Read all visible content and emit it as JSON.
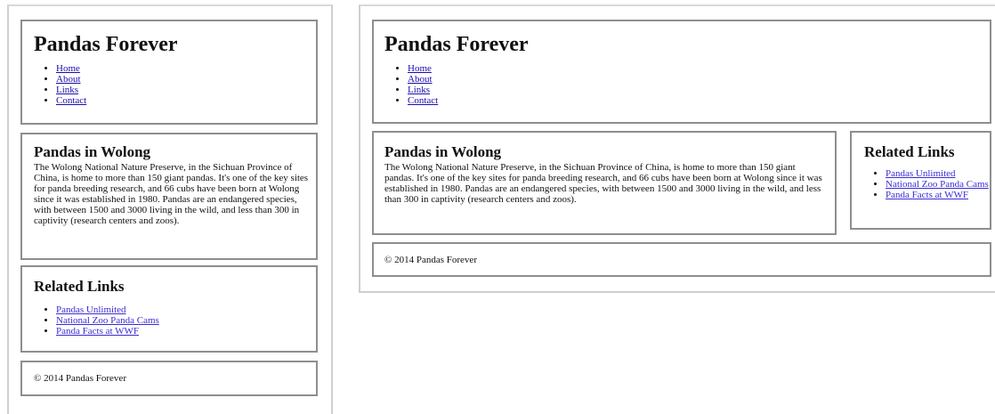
{
  "site_title": "Pandas Forever",
  "nav": [
    "Home",
    "About",
    "Links",
    "Contact"
  ],
  "article": {
    "heading": "Pandas in Wolong",
    "text": "The Wolong National Nature Preserve, in the Sichuan Province of China, is home to more than 150 giant pandas. It's one of the key sites for panda breeding research, and 66 cubs have been born at Wolong since it was established in 1980. Pandas are an endangered species, with between 1500 and 3000 living in the wild, and less than 300 in captivity (research centers and zoos)."
  },
  "related": {
    "heading": "Related Links",
    "links": [
      "Pandas Unlimited",
      "National Zoo Panda Cams",
      "Panda Facts at WWF"
    ]
  },
  "footer": "© 2014 Pandas Forever",
  "colors": {
    "border": "#8e8e8e",
    "frame": "#cfcfcf",
    "link": "#1a0dab"
  }
}
